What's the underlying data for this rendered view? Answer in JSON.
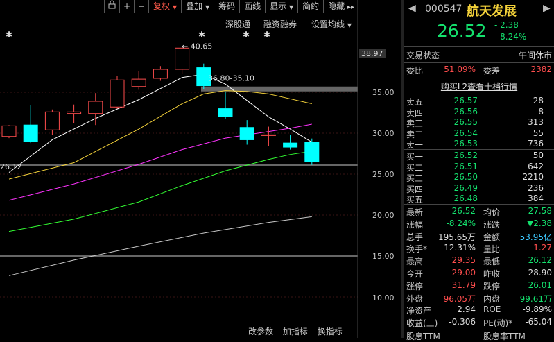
{
  "toolbar": {
    "buttons": [
      "复权",
      "叠加",
      "筹码",
      "画线",
      "显示",
      "简约",
      "隐藏"
    ],
    "icons": [
      "lock-icon",
      "plus-icon",
      "minus-icon"
    ],
    "expand_glyph": "▸▸",
    "active_color": "#ff5a4a"
  },
  "subbar": {
    "links": [
      "深股通",
      "融资融券",
      "设置均线"
    ]
  },
  "axis": {
    "ticks": [
      "35.00",
      "30.00",
      "25.00",
      "20.00",
      "15.00",
      "10.00"
    ],
    "highlight": "38.97"
  },
  "annotations": {
    "high": "40.65",
    "range": "36.80-35.10",
    "low": "26.12"
  },
  "bottom_tabs": [
    "改参数",
    "加指标",
    "换指标"
  ],
  "header": {
    "code": "000547",
    "name": "航天发展",
    "price": "26.52",
    "change": "- 2.38",
    "change_pct": "- 8.24%"
  },
  "status": {
    "label": "交易状态",
    "value": "午间休市"
  },
  "weibi": {
    "label1": "委比",
    "value1": "51.09%",
    "label2": "委差",
    "value2": "2382"
  },
  "l2_link": "购买L2查看十档行情",
  "sell_book": [
    {
      "label": "卖五",
      "price": "26.57",
      "vol": "28"
    },
    {
      "label": "卖四",
      "price": "26.56",
      "vol": "8"
    },
    {
      "label": "卖三",
      "price": "26.55",
      "vol": "313"
    },
    {
      "label": "卖二",
      "price": "26.54",
      "vol": "55"
    },
    {
      "label": "卖一",
      "price": "26.53",
      "vol": "736"
    }
  ],
  "buy_book": [
    {
      "label": "买一",
      "price": "26.52",
      "vol": "50"
    },
    {
      "label": "买二",
      "price": "26.51",
      "vol": "642"
    },
    {
      "label": "买三",
      "price": "26.50",
      "vol": "2210"
    },
    {
      "label": "买四",
      "price": "26.49",
      "vol": "236"
    },
    {
      "label": "买五",
      "price": "26.48",
      "vol": "384"
    }
  ],
  "stats": [
    {
      "l1": "最新",
      "v1": "26.52",
      "c1": "dn",
      "l2": "均价",
      "v2": "27.58",
      "c2": "dn"
    },
    {
      "l1": "涨幅",
      "v1": "-8.24%",
      "c1": "dn",
      "l2": "涨跌",
      "v2": "▼2.38",
      "c2": "dn"
    },
    {
      "l1": "总手",
      "v1": "195.65万",
      "c1": "wht",
      "l2": "金额",
      "v2": "53.95亿",
      "c2": "cyan"
    },
    {
      "l1": "换手*",
      "v1": "12.31%",
      "c1": "wht",
      "l2": "量比",
      "v2": "1.27",
      "c2": "up"
    },
    {
      "l1": "最高",
      "v1": "29.35",
      "c1": "up",
      "l2": "最低",
      "v2": "26.12",
      "c2": "dn"
    },
    {
      "l1": "今开",
      "v1": "29.00",
      "c1": "up",
      "l2": "昨收",
      "v2": "28.90",
      "c2": "wht"
    },
    {
      "l1": "涨停",
      "v1": "31.79",
      "c1": "up",
      "l2": "跌停",
      "v2": "26.01",
      "c2": "dn"
    },
    {
      "l1": "外盘",
      "v1": "96.05万",
      "c1": "up",
      "l2": "内盘",
      "v2": "99.61万",
      "c2": "dn"
    },
    {
      "l1": "净资产",
      "v1": "2.94",
      "c1": "wht",
      "l2": "ROE",
      "v2": "-9.89%",
      "c2": "wht"
    },
    {
      "l1": "收益(三)",
      "v1": "-0.306",
      "c1": "wht",
      "l2": "PE(动)*",
      "v2": "-65.04",
      "c2": "wht"
    }
  ],
  "cut_labels": [
    "股息TTM",
    "股息率TTM"
  ],
  "chart_data": {
    "type": "candlestick",
    "ylim": [
      8,
      42
    ],
    "candles": [
      {
        "o": 29.6,
        "c": 30.9,
        "h": 31.0,
        "l": 29.4
      },
      {
        "o": 31.0,
        "c": 29.0,
        "h": 33.4,
        "l": 28.8
      },
      {
        "o": 30.4,
        "c": 32.6,
        "h": 32.9,
        "l": 29.8
      },
      {
        "o": 32.4,
        "c": 32.6,
        "h": 33.5,
        "l": 31.2
      },
      {
        "o": 32.4,
        "c": 33.9,
        "h": 34.9,
        "l": 31.0
      },
      {
        "o": 33.2,
        "c": 36.5,
        "h": 37.0,
        "l": 33.0
      },
      {
        "o": 35.7,
        "c": 36.6,
        "h": 37.6,
        "l": 35.3
      },
      {
        "o": 36.7,
        "c": 37.8,
        "h": 38.2,
        "l": 36.4
      },
      {
        "o": 37.8,
        "c": 40.4,
        "h": 40.65,
        "l": 37.2
      },
      {
        "o": 38.0,
        "c": 35.8,
        "h": 38.5,
        "l": 35.4
      },
      {
        "o": 33.0,
        "c": 32.0,
        "h": 35.1,
        "l": 31.7
      },
      {
        "o": 30.7,
        "c": 29.2,
        "h": 31.6,
        "l": 28.6
      },
      {
        "o": 29.8,
        "c": 29.8,
        "h": 30.8,
        "l": 28.4
      },
      {
        "o": 28.8,
        "c": 28.3,
        "h": 29.8,
        "l": 28.0
      },
      {
        "o": 28.9,
        "c": 26.52,
        "h": 29.35,
        "l": 26.12
      }
    ],
    "ma_series": [
      {
        "color": "#ffffff",
        "x": [
          0,
          2,
          4,
          6,
          8,
          9,
          10,
          11,
          12,
          13,
          14
        ],
        "y": [
          25.2,
          29.2,
          31.8,
          34.1,
          36.8,
          37.2,
          36.0,
          34.0,
          32.0,
          30.5,
          28.9
        ]
      },
      {
        "color": "#f4d23a",
        "x": [
          0,
          3,
          6,
          8,
          9,
          10,
          11,
          12,
          13,
          14
        ],
        "y": [
          24.4,
          26.4,
          30.5,
          33.6,
          34.8,
          35.2,
          35.1,
          34.8,
          34.2,
          33.6
        ]
      },
      {
        "color": "#ff33ff",
        "x": [
          0,
          3,
          6,
          8,
          10,
          11,
          12,
          13,
          14
        ],
        "y": [
          21.8,
          23.8,
          26.2,
          28.0,
          29.4,
          29.8,
          30.2,
          30.6,
          31.1
        ]
      },
      {
        "color": "#33ff33",
        "x": [
          0,
          3,
          6,
          8,
          10,
          12,
          13,
          14
        ],
        "y": [
          18.0,
          19.5,
          21.6,
          23.6,
          25.4,
          26.8,
          27.4,
          27.8
        ]
      },
      {
        "color": "#c8c8c8",
        "x": [
          0,
          3,
          6,
          9,
          12,
          14
        ],
        "y": [
          12.6,
          14.5,
          16.2,
          17.8,
          19.1,
          19.8
        ]
      }
    ]
  },
  "colors": {
    "up": "#ff4d4d",
    "down": "#14e06d",
    "down_candle": "#00ffff",
    "price_name": "#f4d23a"
  }
}
